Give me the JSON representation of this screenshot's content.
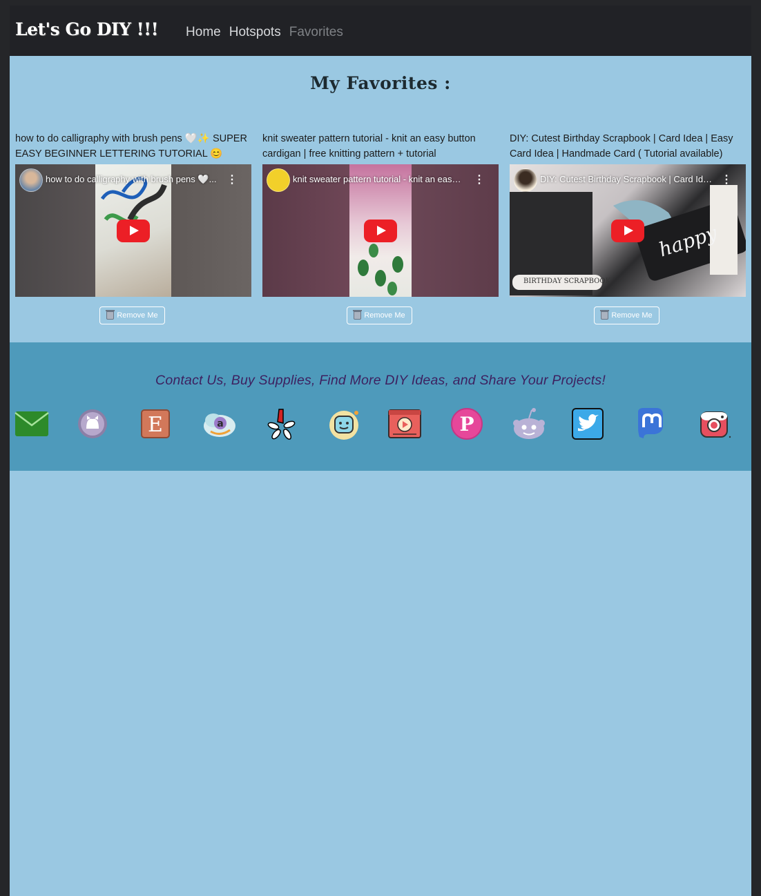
{
  "navbar": {
    "brand": "Let's Go DIY !!!",
    "links": [
      {
        "label": "Home",
        "active": false
      },
      {
        "label": "Hotspots",
        "active": false
      },
      {
        "label": "Favorites",
        "active": true
      }
    ]
  },
  "main": {
    "title": "My Favorites :",
    "cards": [
      {
        "title": "how to do calligraphy with brush pens 🤍✨ SUPER EASY BEGINNER LETTERING TUTORIAL 😊#shorts",
        "video_title": "how to do calligraphy with brush pens 🤍...",
        "remove_label": "Remove Me"
      },
      {
        "title": "knit sweater pattern tutorial - knit an easy button cardigan | free knitting pattern + tutorial",
        "video_title": "knit sweater pattern tutorial - knit an easy ...",
        "remove_label": "Remove Me"
      },
      {
        "title": "DIY: Cutest Birthday Scrapbook | Card Idea | Easy Card Idea | Handmade Card ( Tutorial available)",
        "video_title": "DIY: Cutest Birthday Scrapbook | Card Idea...",
        "remove_label": "Remove Me"
      }
    ]
  },
  "footer": {
    "heading": "Contact Us, Buy Supplies, Find More DIY Ideas, and Share Your Projects!",
    "icons": [
      "envelope-icon",
      "github-icon",
      "etsy-icon",
      "amazon-icon",
      "yelp-icon",
      "waze-icon",
      "video-player-icon",
      "pinterest-icon",
      "reddit-icon",
      "twitter-icon",
      "mastodon-icon",
      "instagram-icon"
    ]
  },
  "colors": {
    "page_bg": "#9ac8e2",
    "navbar_bg": "#212226",
    "footer_bg": "#4e9abb",
    "footer_heading": "#3d2160",
    "play_red": "#ec1f26"
  }
}
